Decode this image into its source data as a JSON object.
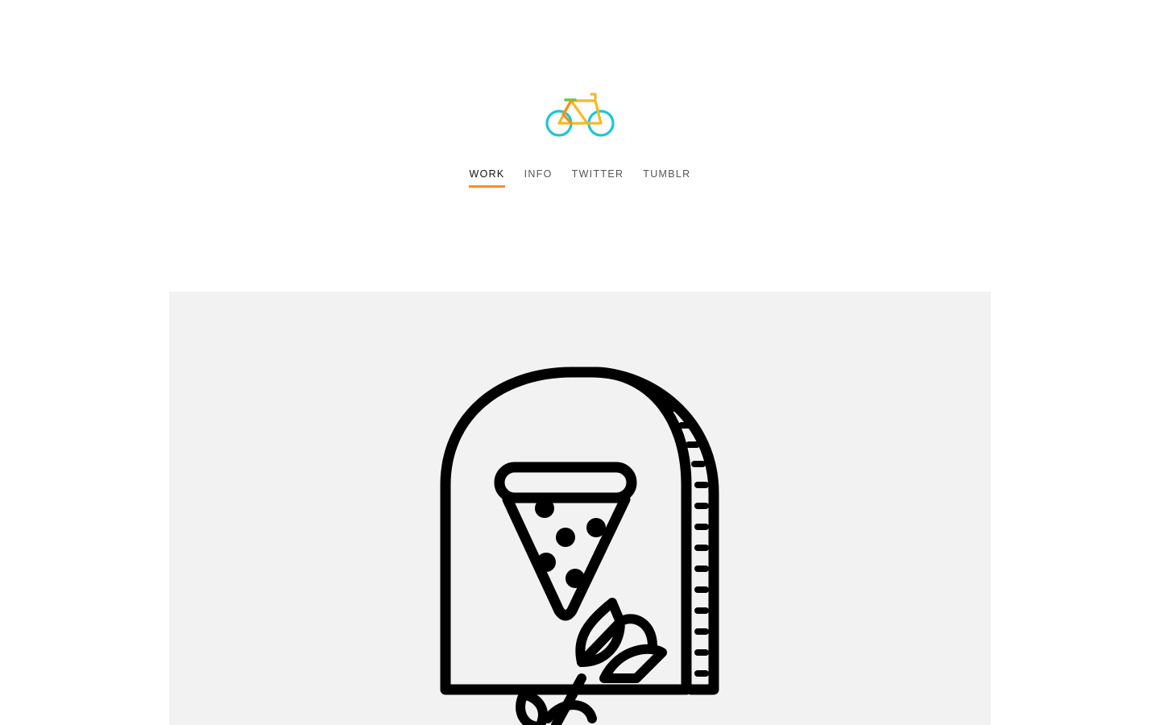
{
  "brand": {
    "logo_icon": "bicycle-icon",
    "colors": {
      "frame": "#f6b925",
      "wheels": "#1cc6d8",
      "seat": "#5ccc4c",
      "fork": "#f7901e"
    }
  },
  "nav": {
    "items": [
      {
        "label": "WORK",
        "active": true
      },
      {
        "label": "INFO",
        "active": false
      },
      {
        "label": "TWITTER",
        "active": false
      },
      {
        "label": "TUMBLR",
        "active": false
      }
    ],
    "accent": "#f7901e"
  },
  "hero": {
    "icon": "pizza-slice-oven-icon",
    "background": "#f2f2f2"
  }
}
